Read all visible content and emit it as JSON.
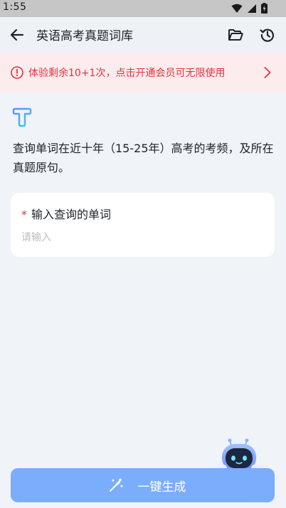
{
  "status_bar": {
    "time": "1:55",
    "icons": [
      "wifi-icon",
      "signal-icon",
      "battery-charging-icon"
    ]
  },
  "app_bar": {
    "title": "英语高考真题词库",
    "icons": [
      "back-arrow-icon",
      "folder-open-icon",
      "history-icon"
    ]
  },
  "notice": {
    "text": "体验剩余10+1次，点击开通会员可无限使用",
    "icon": "alert-circle-icon",
    "arrow_icon": "chevron-right-icon",
    "color": "#e0353c",
    "background": "#fdeced"
  },
  "main": {
    "logo_icon": "tool-logo-icon",
    "description": "查询单词在近十年（15-25年）高考的考频，及所在真题原句。",
    "input": {
      "required_mark": "*",
      "label": "输入查询的单词",
      "placeholder": "请输入",
      "value": ""
    }
  },
  "generate_button": {
    "label": "一键生成",
    "icon": "magic-wand-icon",
    "background": "#7aadfb"
  },
  "mascot": {
    "icon": "robot-mascot-icon"
  }
}
